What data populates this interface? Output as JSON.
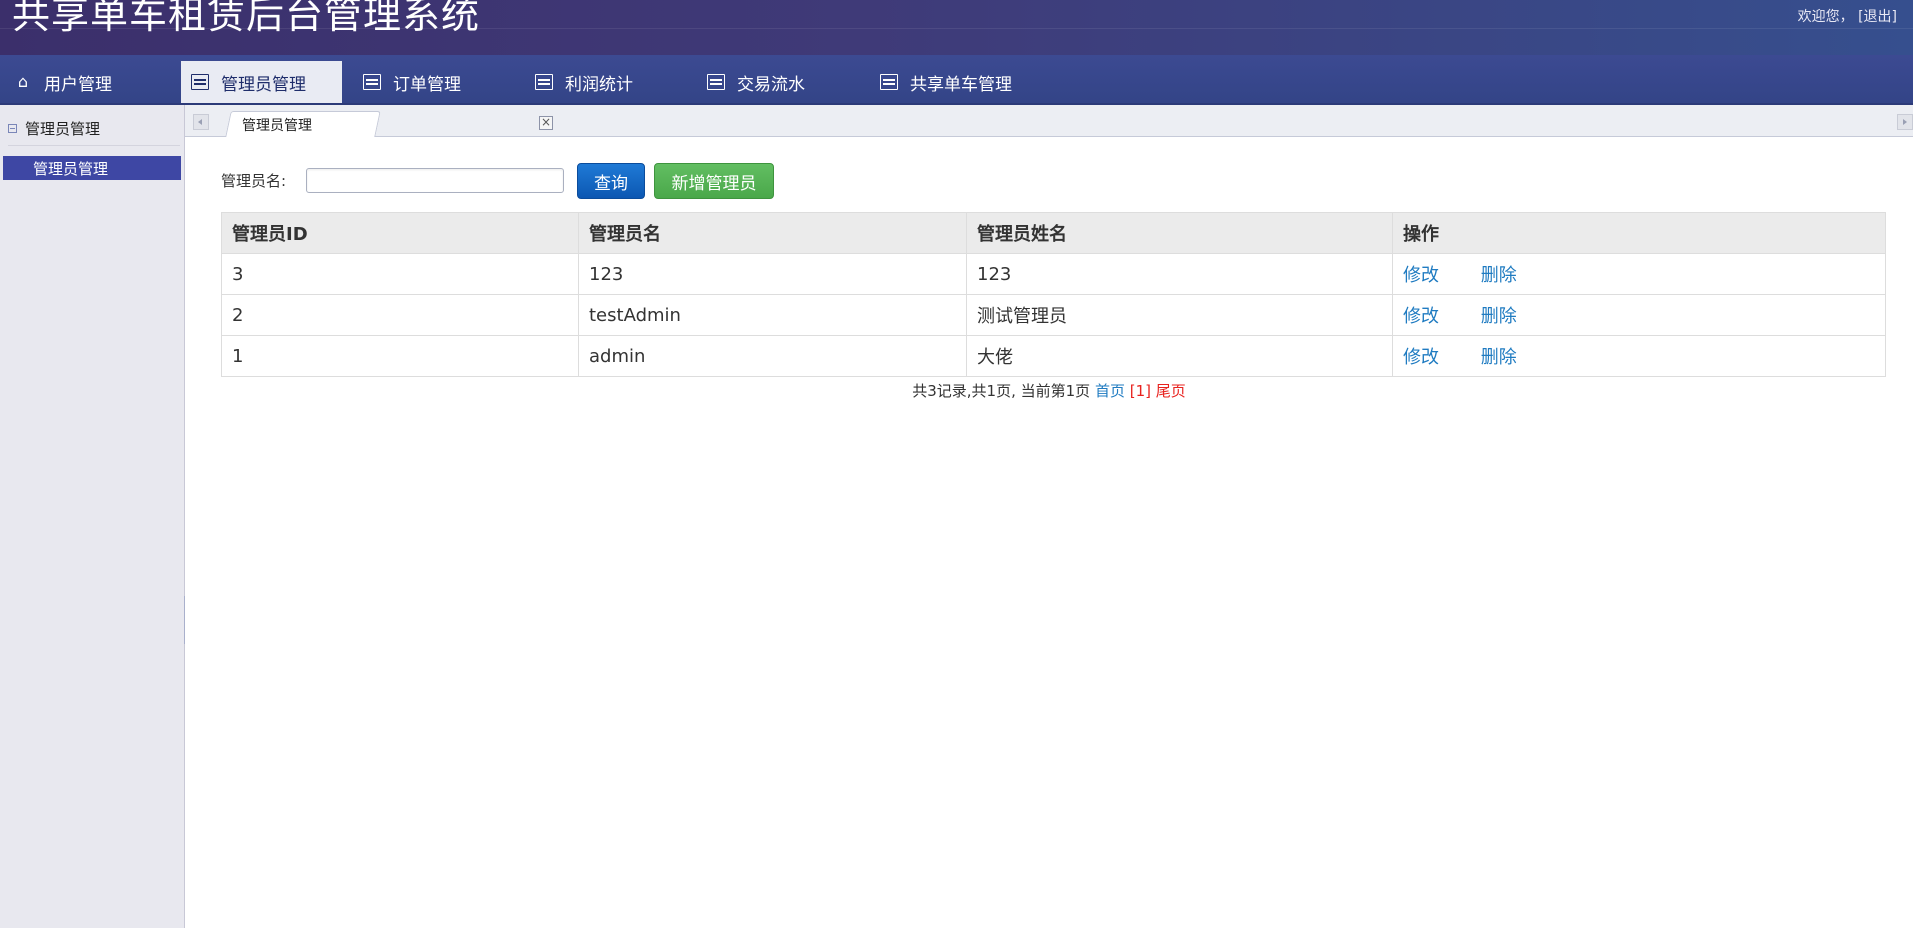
{
  "header": {
    "title": "共享单车租赁后台管理系统",
    "welcome": "欢迎您，",
    "logout": "[退出]"
  },
  "nav": {
    "items": [
      {
        "label": "用户管理",
        "icon": "home-icon"
      },
      {
        "label": "管理员管理",
        "icon": "list-icon"
      },
      {
        "label": "订单管理",
        "icon": "list-icon"
      },
      {
        "label": "利润统计",
        "icon": "list-icon"
      },
      {
        "label": "交易流水",
        "icon": "list-icon"
      },
      {
        "label": "共享单车管理",
        "icon": "list-icon"
      }
    ],
    "active": "管理员管理"
  },
  "sidebar": {
    "section_title": "管理员管理",
    "items": [
      {
        "label": "管理员管理"
      }
    ]
  },
  "tabs": {
    "open": [
      {
        "label": "管理员管理"
      }
    ]
  },
  "search": {
    "label": "管理员名:",
    "value": "",
    "query_button": "查询",
    "add_button": "新增管理员"
  },
  "table": {
    "headers": [
      "管理员ID",
      "管理员名",
      "管理员姓名",
      "操作"
    ],
    "rows": [
      {
        "id": "3",
        "name": "123",
        "real_name": "123"
      },
      {
        "id": "2",
        "name": "testAdmin",
        "real_name": "测试管理员"
      },
      {
        "id": "1",
        "name": "admin",
        "real_name": "大佬"
      }
    ],
    "actions": {
      "edit": "修改",
      "delete": "删除"
    }
  },
  "pager": {
    "summary": "共3记录,共1页, 当前第1页",
    "first": "首页",
    "current": "[1]",
    "last": "尾页"
  },
  "colors": {
    "header_bg": "#3b2f6b",
    "nav_bg": "#3c4a92",
    "sidebar_active": "#3e47a4",
    "query_button": "#1f7ad6",
    "add_button": "#5cb85c",
    "link": "#1f7bc1",
    "pager_current": "#e8221e"
  }
}
